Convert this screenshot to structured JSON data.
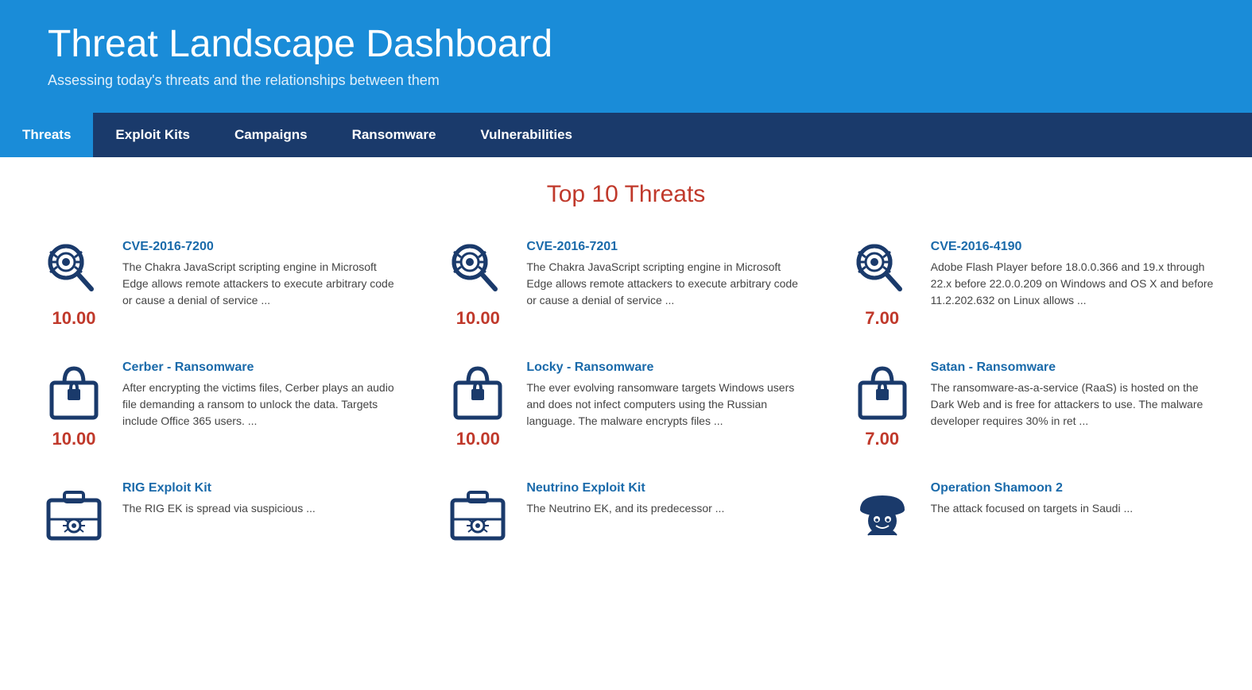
{
  "header": {
    "title": "Threat Landscape Dashboard",
    "subtitle": "Assessing today's threats and the relationships between them"
  },
  "nav": {
    "items": [
      {
        "label": "Threats",
        "active": true
      },
      {
        "label": "Exploit Kits",
        "active": false
      },
      {
        "label": "Campaigns",
        "active": false
      },
      {
        "label": "Ransomware",
        "active": false
      },
      {
        "label": "Vulnerabilities",
        "active": false
      }
    ]
  },
  "main": {
    "section_title": "Top 10 Threats",
    "threats": [
      {
        "name": "CVE-2016-7200",
        "score": "10.00",
        "icon_type": "bug-search",
        "desc": "The Chakra JavaScript scripting engine in Microsoft Edge allows remote attackers to execute arbitrary code or cause a denial of service ..."
      },
      {
        "name": "CVE-2016-7201",
        "score": "10.00",
        "icon_type": "bug-search",
        "desc": "The Chakra JavaScript scripting engine in Microsoft Edge allows remote attackers to execute arbitrary code or cause a denial of service ..."
      },
      {
        "name": "CVE-2016-4190",
        "score": "7.00",
        "icon_type": "bug-search",
        "desc": "Adobe Flash Player before 18.0.0.366 and 19.x through 22.x before 22.0.0.209 on Windows and OS X and before 11.2.202.632 on Linux allows ..."
      },
      {
        "name": "Cerber - Ransomware",
        "score": "10.00",
        "icon_type": "ransomware",
        "desc": "After encrypting the victims files, Cerber plays an audio file demanding a ransom to unlock the data. Targets include Office 365 users. ..."
      },
      {
        "name": "Locky - Ransomware",
        "score": "10.00",
        "icon_type": "ransomware",
        "desc": "The ever evolving ransomware targets Windows users and does not infect computers using the Russian language. The malware encrypts files ..."
      },
      {
        "name": "Satan - Ransomware",
        "score": "7.00",
        "icon_type": "ransomware",
        "desc": "The ransomware-as-a-service (RaaS) is hosted on the Dark Web and is free for attackers to use. The malware developer requires 30% in ret ..."
      },
      {
        "name": "RIG Exploit Kit",
        "score": "",
        "icon_type": "exploit-kit",
        "desc": "The RIG EK is spread via suspicious ..."
      },
      {
        "name": "Neutrino Exploit Kit",
        "score": "",
        "icon_type": "exploit-kit",
        "desc": "The Neutrino EK, and its predecessor ..."
      },
      {
        "name": "Operation Shamoon 2",
        "score": "",
        "icon_type": "campaign",
        "desc": "The attack focused on targets in Saudi ..."
      }
    ]
  },
  "colors": {
    "header_bg": "#1a8cd8",
    "nav_bg": "#1a3a6b",
    "nav_active": "#1a8cd8",
    "score_color": "#c0392b",
    "link_color": "#1a6aaa",
    "section_title_color": "#c0392b"
  }
}
